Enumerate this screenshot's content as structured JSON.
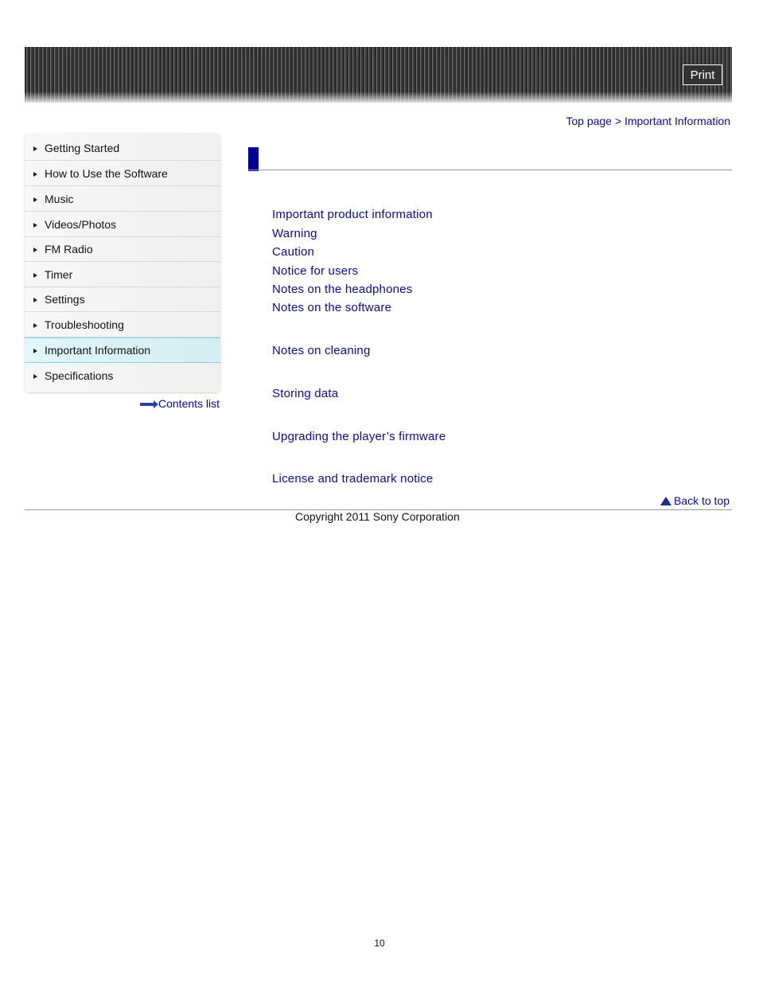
{
  "header": {
    "print_label": "Print"
  },
  "breadcrumb": {
    "top_page": "Top page",
    "separator": " > ",
    "current": "Important Information"
  },
  "sidebar": {
    "items": [
      {
        "label": "Getting Started",
        "active": false
      },
      {
        "label": "How to Use the Software",
        "active": false
      },
      {
        "label": "Music",
        "active": false
      },
      {
        "label": "Videos/Photos",
        "active": false
      },
      {
        "label": "FM Radio",
        "active": false
      },
      {
        "label": "Timer",
        "active": false
      },
      {
        "label": "Settings",
        "active": false
      },
      {
        "label": "Troubleshooting",
        "active": false
      },
      {
        "label": "Important Information",
        "active": true
      },
      {
        "label": "Specifications",
        "active": false
      }
    ],
    "contents_list": "Contents list"
  },
  "main": {
    "links": [
      "Important product information",
      "Warning",
      "Caution",
      "Notice for users",
      "Notes on the headphones",
      "Notes on the software",
      "Notes on cleaning",
      "Storing data",
      "Upgrading the player’s firmware",
      "License and trademark notice"
    ],
    "back_to_top": "Back to top"
  },
  "footer": {
    "copyright": "Copyright 2011 Sony Corporation",
    "page_number": "10"
  },
  "colors": {
    "link": "#0a0a99",
    "title_accent": "#000099",
    "active_item": "#e0f6fa"
  }
}
